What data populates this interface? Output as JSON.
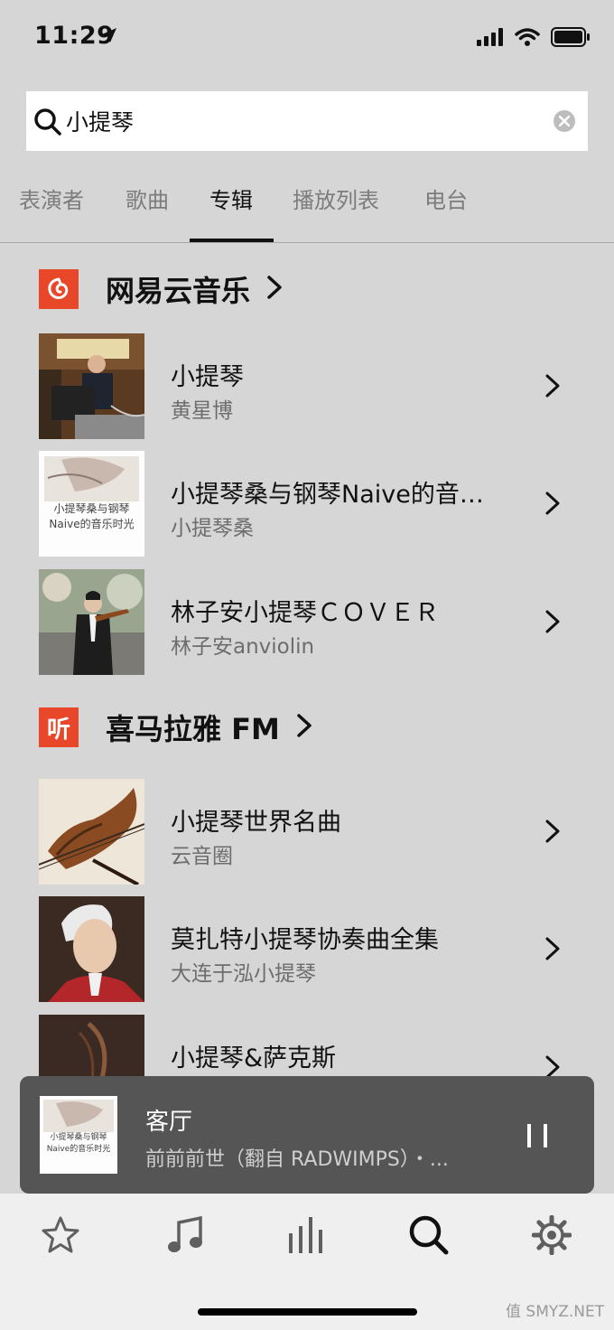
{
  "status_bar": {
    "time": "11:29"
  },
  "search": {
    "query": "小提琴"
  },
  "tabs": [
    {
      "label": "表演者"
    },
    {
      "label": "歌曲"
    },
    {
      "label": "专辑"
    },
    {
      "label": "播放列表"
    },
    {
      "label": "电台"
    }
  ],
  "active_tab": "专辑",
  "sections": [
    {
      "title": "网易云音乐",
      "items": [
        {
          "title": "小提琴",
          "subtitle": "黄星博"
        },
        {
          "title": "小提琴桑与钢琴Naive的音乐时光",
          "subtitle": "小提琴桑"
        },
        {
          "title": "林子安小提琴ＣＯＶＥＲ",
          "subtitle": "林子安anviolin"
        }
      ]
    },
    {
      "title": "喜马拉雅 FM",
      "logo_text": "听",
      "items": [
        {
          "title": "小提琴世界名曲",
          "subtitle": "云音圈"
        },
        {
          "title": "莫扎特小提琴协奏曲全集",
          "subtitle": "大连于泓小提琴"
        },
        {
          "title": "小提琴&萨克斯",
          "subtitle": ""
        }
      ]
    }
  ],
  "album_art_text": {
    "line1": "小提琴桑与钢琴",
    "line2": "Naive的音乐时光"
  },
  "now_playing": {
    "room": "客厅",
    "track": "前前前世（翻自 RADWIMPS）・..."
  },
  "bottom_nav": [
    {
      "icon": "star-icon"
    },
    {
      "icon": "music-note-icon"
    },
    {
      "icon": "equalizer-icon"
    },
    {
      "icon": "search-icon"
    },
    {
      "icon": "gear-icon"
    }
  ],
  "watermark": "值 SMYZ.NET",
  "colors": {
    "accent": "#e8472a",
    "background": "#d6d6d6",
    "player": "#555555"
  }
}
